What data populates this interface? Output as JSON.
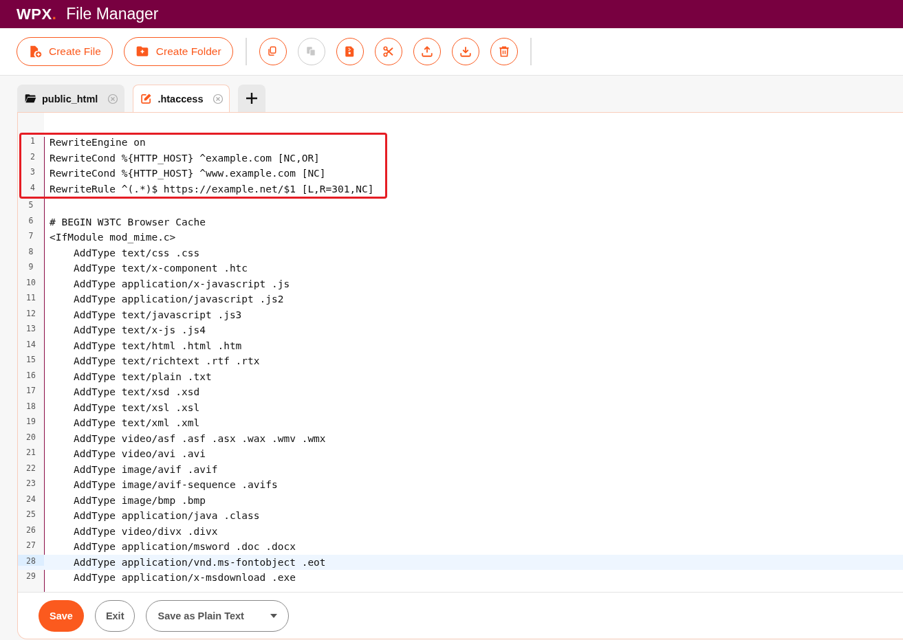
{
  "header": {
    "logo": "WPX",
    "logo_dot": ".",
    "title": "File Manager"
  },
  "toolbar": {
    "buttons": [
      {
        "label": "Create File",
        "kind": "file"
      },
      {
        "label": "Create Folder",
        "kind": "folder"
      }
    ],
    "icon_buttons": [
      {
        "kind": "copy",
        "disabled": false
      },
      {
        "kind": "paste",
        "disabled": true
      },
      {
        "kind": "archive",
        "disabled": false
      },
      {
        "kind": "cut",
        "disabled": false
      },
      {
        "kind": "upload",
        "disabled": false
      },
      {
        "kind": "download",
        "disabled": false
      },
      {
        "kind": "delete",
        "disabled": false
      }
    ]
  },
  "tabs": [
    {
      "label": "public_html",
      "kind": "folder",
      "selected": false
    },
    {
      "label": ".htaccess",
      "kind": "edit",
      "selected": true
    }
  ],
  "editor": {
    "lines": [
      {
        "number": "1",
        "text": "RewriteEngine on",
        "highlighted": true,
        "current": false
      },
      {
        "number": "2",
        "text": "RewriteCond %{HTTP_HOST} ^example.com [NC,OR]",
        "highlighted": true,
        "current": false
      },
      {
        "number": "3",
        "text": "RewriteCond %{HTTP_HOST} ^www.example.com [NC]",
        "highlighted": true,
        "current": false
      },
      {
        "number": "4",
        "text": "RewriteRule ^(.*)$ https://example.net/$1 [L,R=301,NC]",
        "highlighted": true,
        "current": false
      },
      {
        "number": "5",
        "highlighted": false,
        "current": false
      },
      {
        "number": "6",
        "text": "# BEGIN W3TC Browser Cache",
        "highlighted": false,
        "current": false
      },
      {
        "number": "7",
        "text": "<IfModule mod_mime.c>",
        "highlighted": false,
        "current": false
      },
      {
        "number": "8",
        "text": "    AddType text/css .css",
        "highlighted": false,
        "current": false
      },
      {
        "number": "9",
        "text": "    AddType text/x-component .htc",
        "highlighted": false,
        "current": false
      },
      {
        "number": "10",
        "text": "    AddType application/x-javascript .js",
        "highlighted": false,
        "current": false
      },
      {
        "number": "11",
        "text": "    AddType application/javascript .js2",
        "highlighted": false,
        "current": false
      },
      {
        "number": "12",
        "text": "    AddType text/javascript .js3",
        "highlighted": false,
        "current": false
      },
      {
        "number": "13",
        "text": "    AddType text/x-js .js4",
        "highlighted": false,
        "current": false
      },
      {
        "number": "14",
        "text": "    AddType text/html .html .htm",
        "highlighted": false,
        "current": false
      },
      {
        "number": "15",
        "text": "    AddType text/richtext .rtf .rtx",
        "highlighted": false,
        "current": false
      },
      {
        "number": "16",
        "text": "    AddType text/plain .txt",
        "highlighted": false,
        "current": false
      },
      {
        "number": "17",
        "text": "    AddType text/xsd .xsd",
        "highlighted": false,
        "current": false
      },
      {
        "number": "18",
        "text": "    AddType text/xsl .xsl",
        "highlighted": false,
        "current": false
      },
      {
        "number": "19",
        "text": "    AddType text/xml .xml",
        "highlighted": false,
        "current": false
      },
      {
        "number": "20",
        "text": "    AddType video/asf .asf .asx .wax .wmv .wmx",
        "highlighted": false,
        "current": false
      },
      {
        "number": "21",
        "text": "    AddType video/avi .avi",
        "highlighted": false,
        "current": false
      },
      {
        "number": "22",
        "text": "    AddType image/avif .avif",
        "highlighted": false,
        "current": false
      },
      {
        "number": "23",
        "text": "    AddType image/avif-sequence .avifs",
        "highlighted": false,
        "current": false
      },
      {
        "number": "24",
        "text": "    AddType image/bmp .bmp",
        "highlighted": false,
        "current": false
      },
      {
        "number": "25",
        "text": "    AddType application/java .class",
        "highlighted": false,
        "current": false
      },
      {
        "number": "26",
        "text": "    AddType video/divx .divx",
        "highlighted": false,
        "current": false
      },
      {
        "number": "27",
        "text": "    AddType application/msword .doc .docx",
        "highlighted": false,
        "current": false
      },
      {
        "number": "28",
        "text": "    AddType application/vnd.ms-fontobject .eot",
        "highlighted": false,
        "current": true
      },
      {
        "number": "29",
        "text": "    AddType application/x-msdownload .exe",
        "highlighted": false,
        "current": false
      }
    ]
  },
  "footer": {
    "save": "Save",
    "exit": "Exit",
    "format": "Save as Plain Text"
  }
}
